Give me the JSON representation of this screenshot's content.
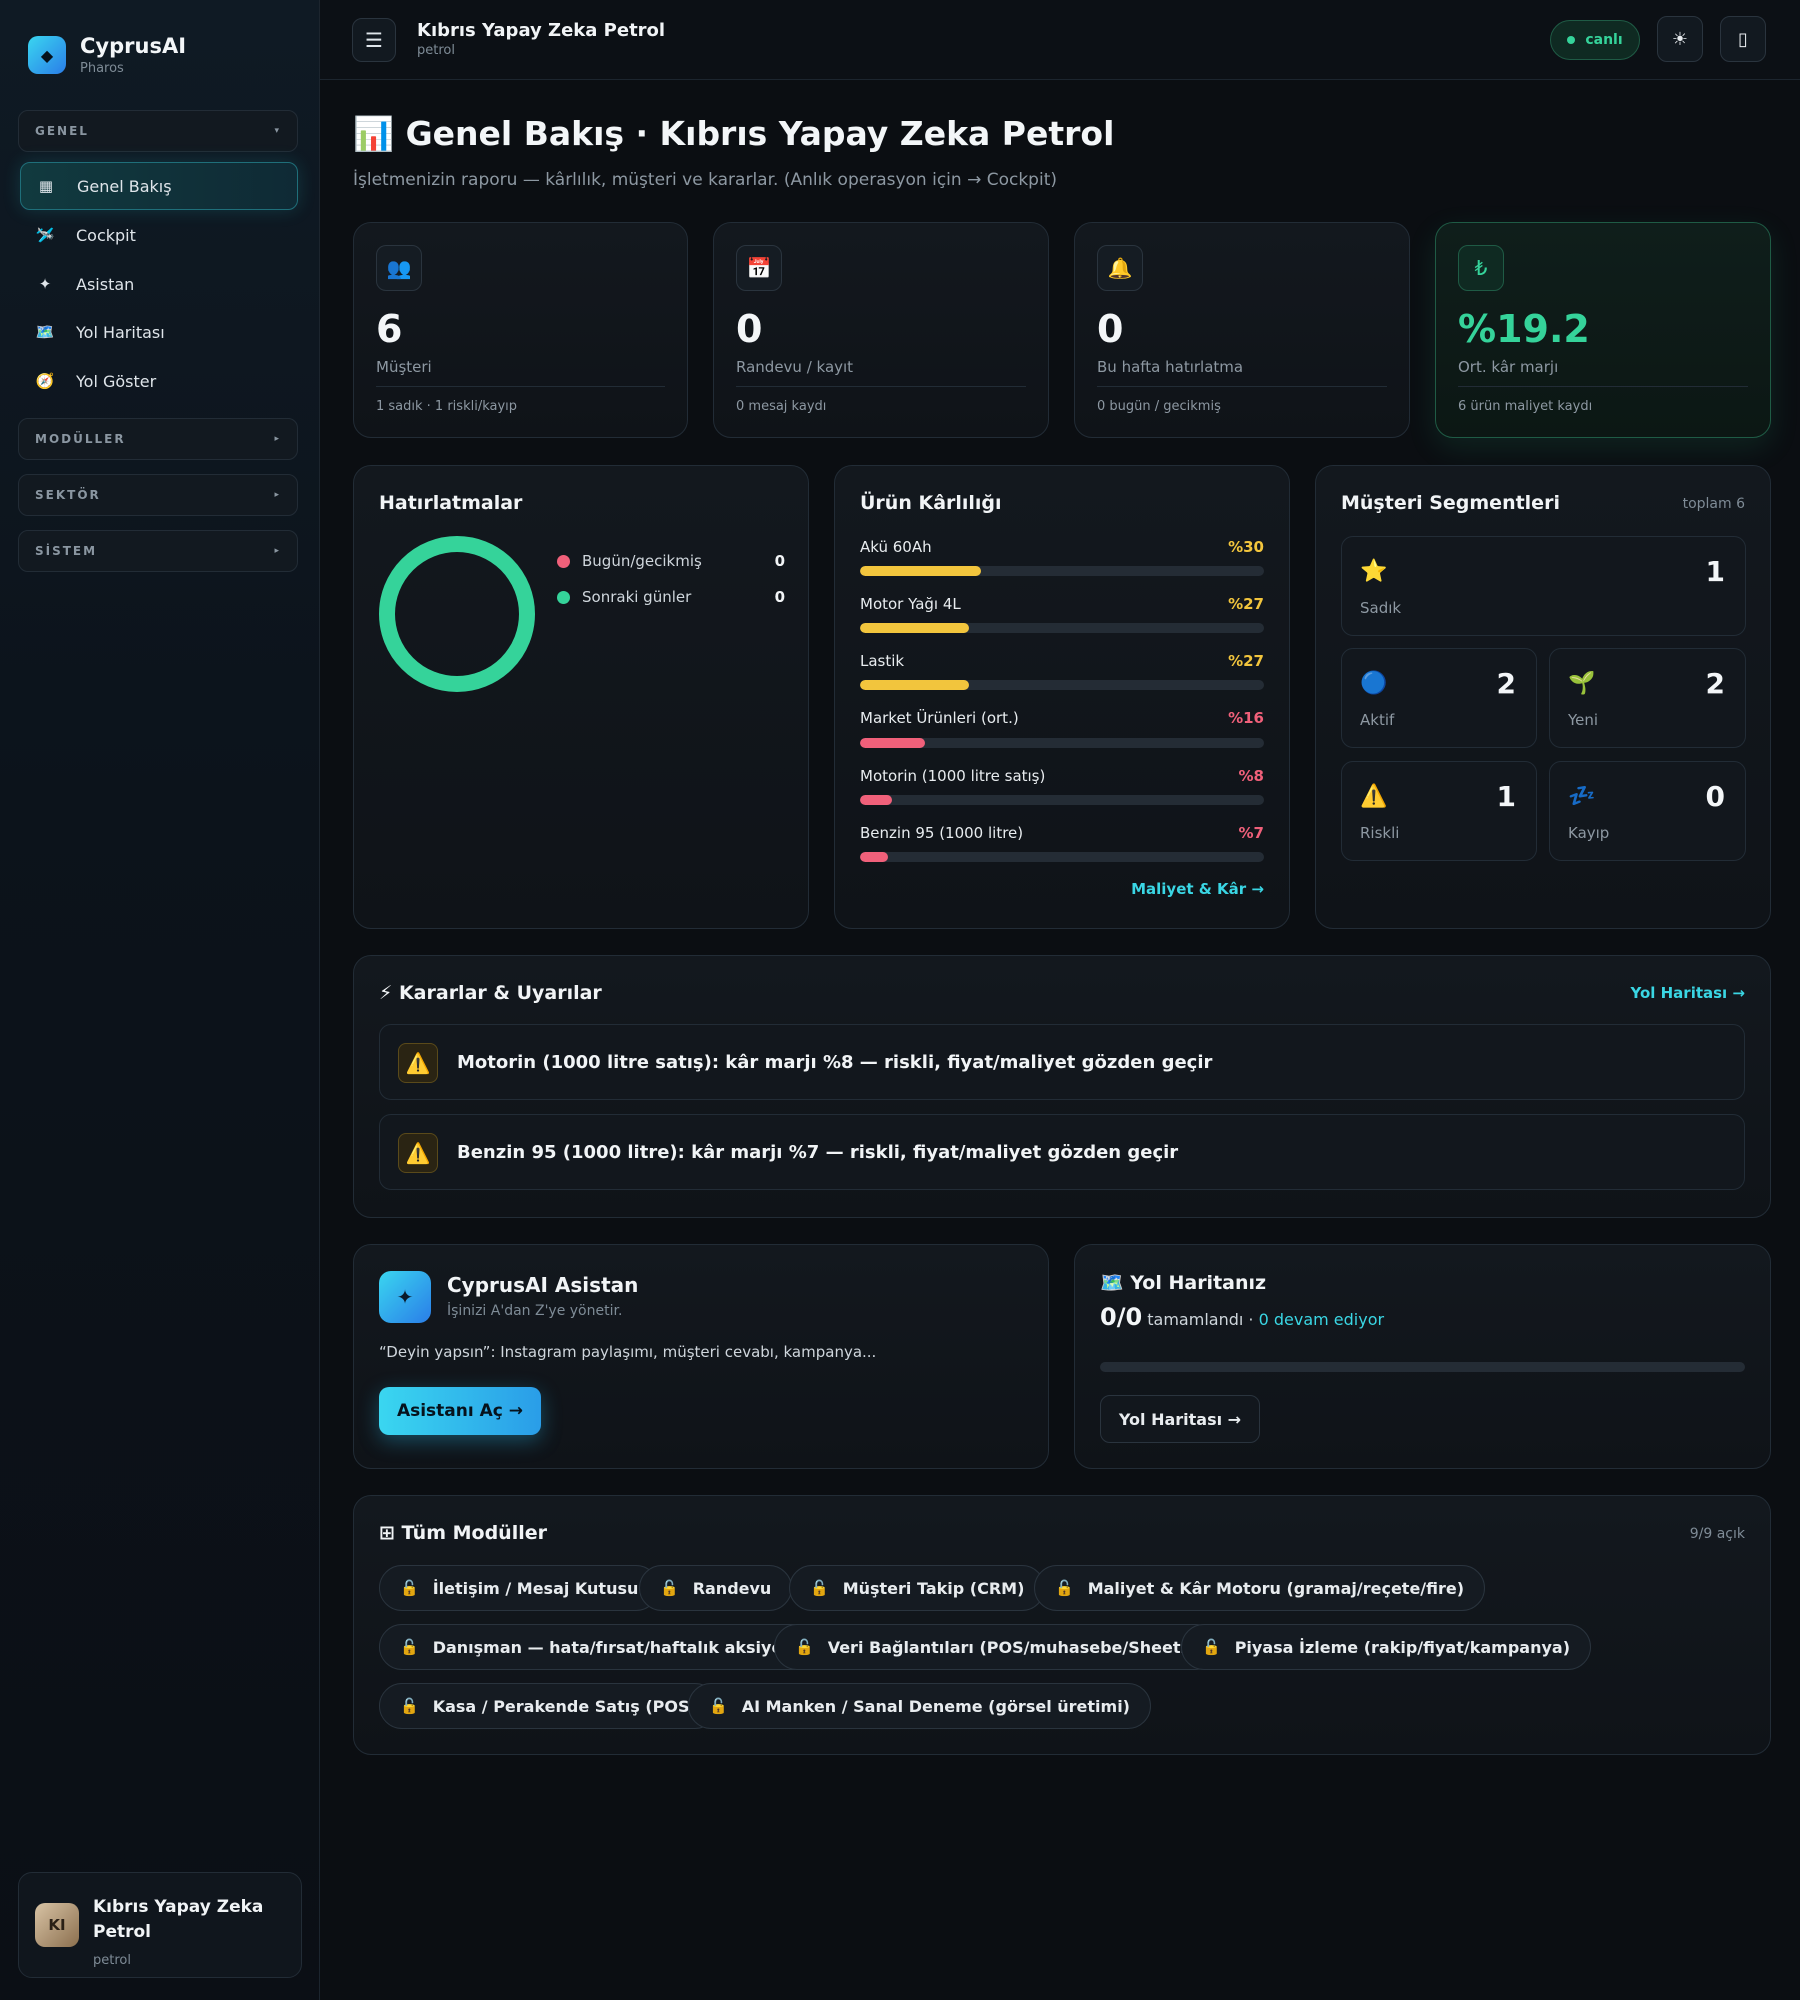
{
  "brand": {
    "title": "CyprusAI",
    "subtitle": "Pharos",
    "logo_icon": "◆"
  },
  "sidebar": {
    "groups": {
      "genel": "GENEL",
      "moduller": "MODÜLLER",
      "sektor": "SEKTÖR",
      "sistem": "SİSTEM"
    },
    "caret_open": "▾",
    "caret_closed": "▸",
    "items": [
      {
        "label": "Genel Bakış",
        "icon": "▦",
        "icon_name": "grid-icon"
      },
      {
        "label": "Cockpit",
        "icon": "🛩️",
        "icon_name": "plane-icon"
      },
      {
        "label": "Asistan",
        "icon": "✦",
        "icon_name": "sparkle-icon"
      },
      {
        "label": "Yol Haritası",
        "icon": "🗺️",
        "icon_name": "map-icon"
      },
      {
        "label": "Yol Göster",
        "icon": "🧭",
        "icon_name": "compass-icon"
      }
    ],
    "user": {
      "initials": "KI",
      "name": "Kıbrıs Yapay Zeka Petrol",
      "role": "petrol"
    }
  },
  "topbar": {
    "menu_icon": "☰",
    "title": "Kıbrıs Yapay Zeka Petrol",
    "subtitle": "petrol",
    "live_label": "canlı",
    "theme_icon": "☀",
    "device_icon": "▯"
  },
  "page": {
    "title": "📊 Genel Bakış · Kıbrıs Yapay Zeka Petrol",
    "subtitle": "İşletmenizin raporu — kârlılık, müşteri ve kararlar. (Anlık operasyon için → Cockpit)"
  },
  "stats": [
    {
      "icon": "👥",
      "value": "6",
      "label": "Müşteri",
      "foot": "1 sadık · 1 riskli/kayıp"
    },
    {
      "icon": "📅",
      "value": "0",
      "label": "Randevu / kayıt",
      "foot": "0 mesaj kaydı"
    },
    {
      "icon": "🔔",
      "value": "0",
      "label": "Bu hafta hatırlatma",
      "foot": "0 bugün / gecikmiş"
    },
    {
      "icon": "₺",
      "value": "%19.2",
      "label": "Ort. kâr marjı",
      "foot": "6 ürün maliyet kaydı"
    }
  ],
  "reminders": {
    "title": "Hatırlatmalar",
    "legend": [
      {
        "label": "Bugün/gecikmiş",
        "value": "0",
        "color": "#f0607a"
      },
      {
        "label": "Sonraki günler",
        "value": "0",
        "color": "#35d39a"
      }
    ]
  },
  "products": {
    "title": "Ürün Kârlılığı",
    "link": "Maliyet & Kâr →",
    "max_percent": 100,
    "items": [
      {
        "label": "Akü 60Ah",
        "value_text": "%30",
        "percent": 30,
        "color": "#f2c53d"
      },
      {
        "label": "Motor Yağı 4L",
        "value_text": "%27",
        "percent": 27,
        "color": "#f2c53d"
      },
      {
        "label": "Lastik",
        "value_text": "%27",
        "percent": 27,
        "color": "#f2c53d"
      },
      {
        "label": "Market Ürünleri (ort.)",
        "value_text": "%16",
        "percent": 16,
        "color": "#f0607a"
      },
      {
        "label": "Motorin (1000 litre satış)",
        "value_text": "%8",
        "percent": 8,
        "color": "#f0607a"
      },
      {
        "label": "Benzin 95 (1000 litre)",
        "value_text": "%7",
        "percent": 7,
        "color": "#f0607a"
      }
    ]
  },
  "segments": {
    "title": "Müşteri Segmentleri",
    "total": "toplam 6",
    "items": [
      {
        "label": "Sadık",
        "count": "1",
        "icon": "⭐"
      },
      {
        "label": "Aktif",
        "count": "2",
        "icon": "🔵"
      },
      {
        "label": "Yeni",
        "count": "2",
        "icon": "🌱"
      },
      {
        "label": "Riskli",
        "count": "1",
        "icon": "⚠️"
      },
      {
        "label": "Kayıp",
        "count": "0",
        "icon": "💤"
      }
    ]
  },
  "decisions": {
    "title": "⚡ Kararlar & Uyarılar",
    "link": "Yol Haritası →",
    "alerts": [
      {
        "icon": "⚠️",
        "text": "Motorin (1000 litre satış): kâr marjı %8 — riskli, fiyat/maliyet gözden geçir"
      },
      {
        "icon": "⚠️",
        "text": "Benzin 95 (1000 litre): kâr marjı %7 — riskli, fiyat/maliyet gözden geçir"
      }
    ]
  },
  "assistant": {
    "icon": "✦",
    "title": "CyprusAI Asistan",
    "subtitle": "İşinizi A'dan Z'ye yönetir.",
    "desc": "“Deyin yapsın”: Instagram paylaşımı, müşteri cevabı, kampanya...",
    "button": "Asistanı Aç →"
  },
  "roadmap": {
    "title": "🗺️ Yol Haritanız",
    "done": "0/0",
    "done_label": "tamamlandı",
    "separator": "·",
    "in_progress": "0 devam ediyor",
    "progress": 0,
    "button": "Yol Haritası →"
  },
  "modules": {
    "title": "⊞ Tüm Modüller",
    "count": "9/9 açık",
    "lock_icon": "🔓",
    "items": [
      "İletişim / Mesaj Kutusu",
      "Randevu",
      "Müşteri Takip (CRM)",
      "Maliyet & Kâr Motoru (gramaj/reçete/fire)",
      "Danışman — hata/fırsat/haftalık aksiyon",
      "Veri Bağlantıları (POS/muhasebe/Sheets)",
      "Piyasa İzleme (rakip/fiyat/kampanya)",
      "Kasa / Perakende Satış (POS)",
      "AI Manken / Sanal Deneme (görsel üretimi)"
    ]
  }
}
